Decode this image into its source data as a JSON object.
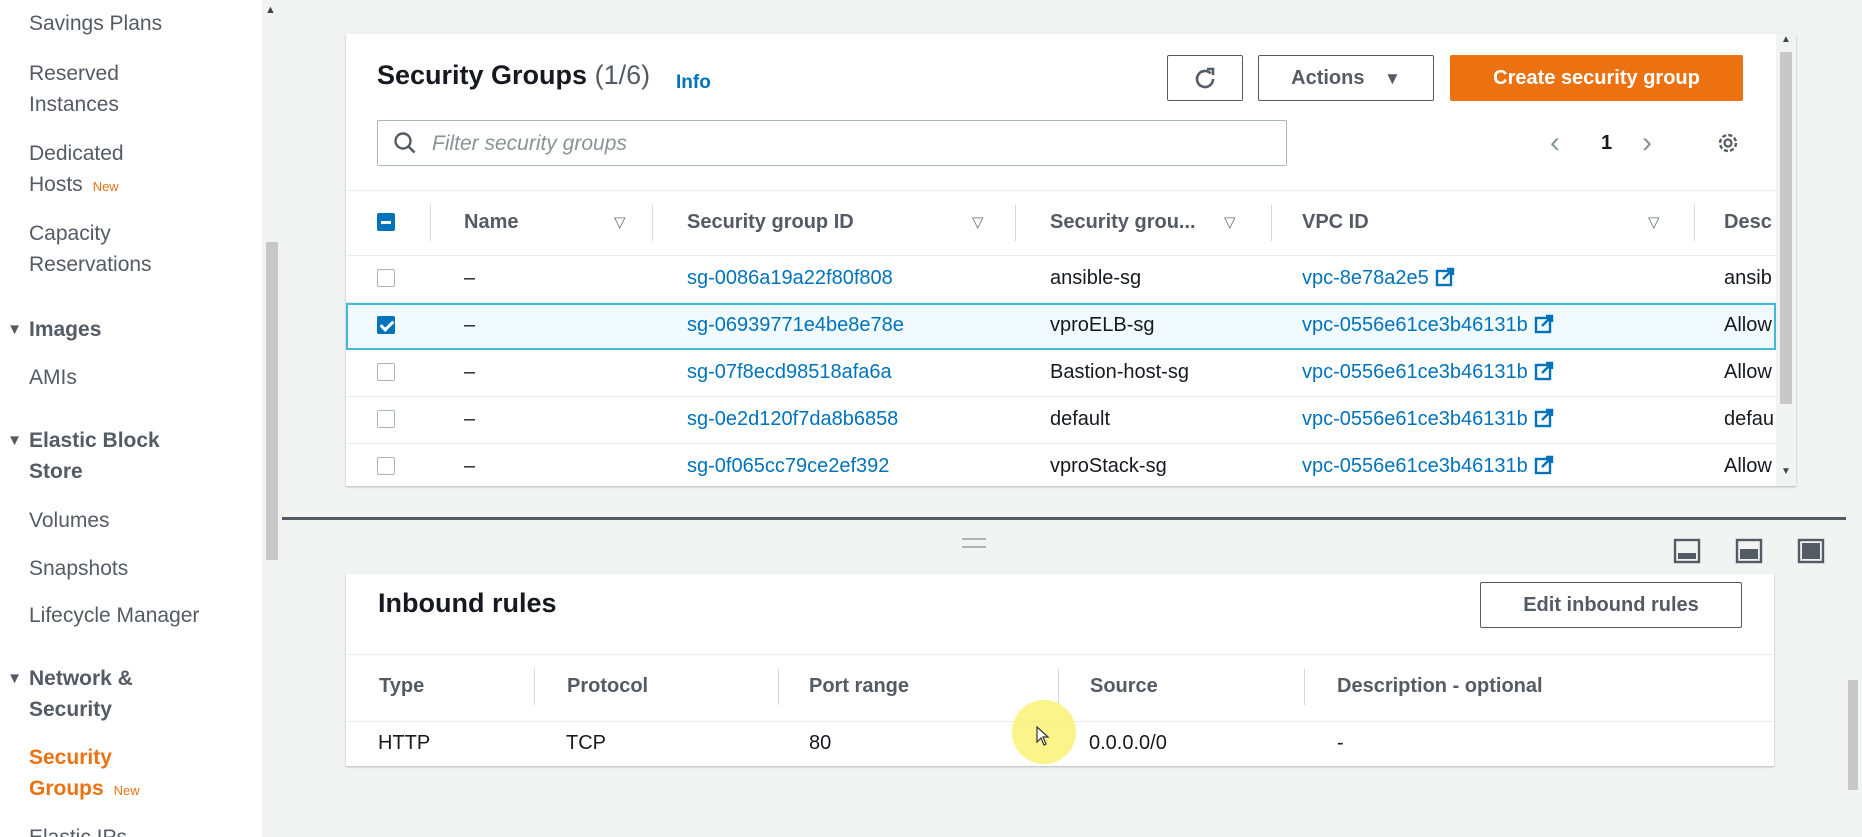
{
  "sidebar": {
    "items": [
      {
        "kind": "link",
        "label": "Savings Plans"
      },
      {
        "kind": "link",
        "label": "Reserved",
        "label2": "Instances"
      },
      {
        "kind": "link",
        "label": "Dedicated",
        "label2": "Hosts",
        "badge": "New"
      },
      {
        "kind": "link",
        "label": "Capacity",
        "label2": "Reservations"
      },
      {
        "kind": "section",
        "label": "Images"
      },
      {
        "kind": "link",
        "label": "AMIs"
      },
      {
        "kind": "section",
        "label": "Elastic Block",
        "label2": "Store"
      },
      {
        "kind": "link",
        "label": "Volumes"
      },
      {
        "kind": "link",
        "label": "Snapshots"
      },
      {
        "kind": "link",
        "label": "Lifecycle Manager"
      },
      {
        "kind": "section",
        "label": "Network &",
        "label2": "Security"
      },
      {
        "kind": "link",
        "label": "Security",
        "label2": "Groups",
        "badge": "New",
        "active": true
      },
      {
        "kind": "link",
        "label": "Elastic IPs"
      }
    ]
  },
  "security_groups": {
    "title": "Security Groups",
    "count": "(1/6)",
    "info": "Info",
    "actions_label": "Actions",
    "create_label": "Create security group",
    "filter_placeholder": "Filter security groups",
    "page": "1",
    "columns": [
      "Name",
      "Security group ID",
      "Security grou...",
      "VPC ID",
      "Desc"
    ],
    "rows": [
      {
        "name": "–",
        "id": "sg-0086a19a22f80f808",
        "group_name": "ansible-sg",
        "vpc": "vpc-8e78a2e5",
        "desc": "ansib",
        "selected": false
      },
      {
        "name": "–",
        "id": "sg-06939771e4be8e78e",
        "group_name": "vproELB-sg",
        "vpc": "vpc-0556e61ce3b46131b",
        "desc": "Allow",
        "selected": true
      },
      {
        "name": "–",
        "id": "sg-07f8ecd98518afa6a",
        "group_name": "Bastion-host-sg",
        "vpc": "vpc-0556e61ce3b46131b",
        "desc": "Allow",
        "selected": false
      },
      {
        "name": "–",
        "id": "sg-0e2d120f7da8b6858",
        "group_name": "default",
        "vpc": "vpc-0556e61ce3b46131b",
        "desc": "defau",
        "selected": false
      },
      {
        "name": "–",
        "id": "sg-0f065cc79ce2ef392",
        "group_name": "vproStack-sg",
        "vpc": "vpc-0556e61ce3b46131b",
        "desc": "Allow",
        "selected": false
      }
    ]
  },
  "inbound_rules": {
    "title": "Inbound rules",
    "edit_label": "Edit inbound rules",
    "columns": [
      "Type",
      "Protocol",
      "Port range",
      "Source",
      "Description - optional"
    ],
    "rows": [
      {
        "type": "HTTP",
        "protocol": "TCP",
        "port": "80",
        "source": "0.0.0.0/0",
        "description": "-"
      }
    ]
  },
  "colors": {
    "accent": "#ec7211",
    "link": "#0073bb",
    "text": "#16191f",
    "muted": "#545b64"
  },
  "icons": [
    "refresh-icon",
    "caret-down-icon",
    "search-icon",
    "chevron-left-icon",
    "chevron-right-icon",
    "settings-icon",
    "sort-icon",
    "external-link-icon",
    "layout-bottom-icon",
    "layout-split-icon",
    "layout-full-icon",
    "drag-handle-icon",
    "cursor-icon"
  ]
}
